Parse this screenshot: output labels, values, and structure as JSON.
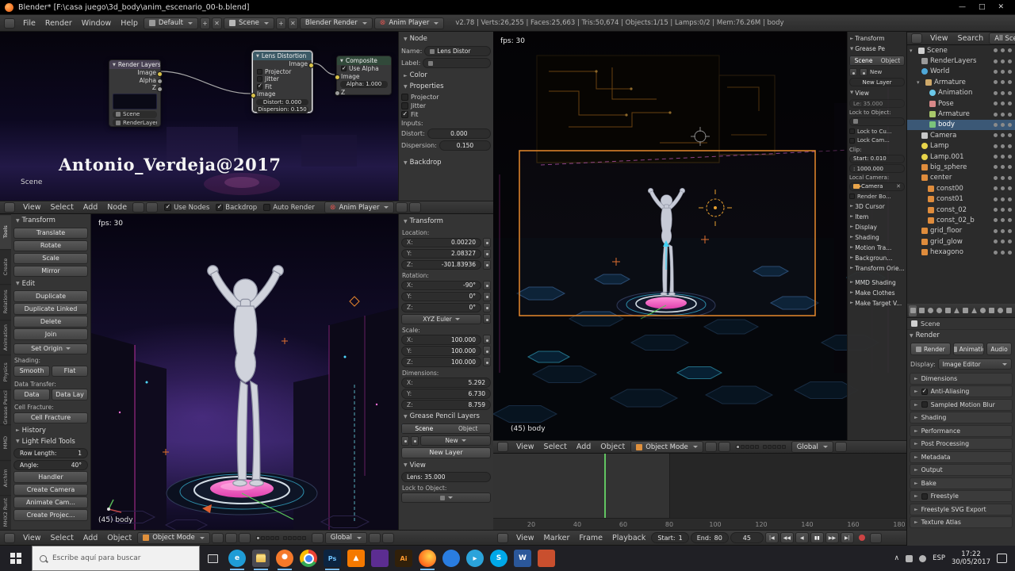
{
  "colors": {
    "accent_blue": "#4f7cb8",
    "selection_orange": "#e8892c",
    "frame_line_green": "#62c462",
    "record_red": "#cc4444",
    "pink_platform": "#f050c0"
  },
  "titlebar": {
    "title": "Blender* [F:\\casa juego\\3d_body\\anim_escenario_00-b.blend]"
  },
  "topbar": {
    "menus": [
      "File",
      "Render",
      "Window",
      "Help"
    ],
    "layout": "Default",
    "scene": "Scene",
    "engine": "Blender Render",
    "anim_player": "Anim Player",
    "stats": "v2.78 | Verts:26,255 | Faces:25,663 | Tris:50,674 | Objects:1/15 | Lamps:0/2 | Mem:76.26M | body"
  },
  "node_editor": {
    "watermark": "Antonio_Verdeja@2017",
    "scene_label": "Scene",
    "header": {
      "menus": [
        "View",
        "Select",
        "Add",
        "Node"
      ],
      "use_nodes": "Use Nodes",
      "backdrop": "Backdrop",
      "auto_render": "Auto Render",
      "anim_player": "Anim Player"
    },
    "render_layers": {
      "title": "Render Layers",
      "out_image": "Image",
      "out_alpha": "Alpha",
      "out_z": "Z",
      "scene": "Scene",
      "layer": "RenderLayer"
    },
    "lens": {
      "title": "Lens Distortion",
      "out_image": "Image",
      "projector": "Projector",
      "jitter": "Jitter",
      "fit": "Fit",
      "in_image": "Image",
      "distort": "Distort: 0.000",
      "dispersion": "Dispersion: 0.150"
    },
    "composite": {
      "title": "Composite",
      "use_alpha": "Use Alpha",
      "image": "Image",
      "alpha": "Alpha: 1.000",
      "z": "Z"
    }
  },
  "node_props": {
    "section_node": "Node",
    "name_label": "Name:",
    "name_value": "Lens Distor",
    "label_label": "Label:",
    "section_color": "Color",
    "section_properties": "Properties",
    "projector": "Projector",
    "jitter": "Jitter",
    "fit": "Fit",
    "inputs_label": "Inputs:",
    "distort_label": "Distort:",
    "distort_value": "0.000",
    "dispersion_label": "Dispersion:",
    "dispersion_value": "0.150",
    "section_backdrop": "Backdrop"
  },
  "tool_shelf": {
    "tabs": [
      "Tools",
      "Create",
      "Relations",
      "Animation",
      "Physics",
      "Grease Pencil",
      "MMD",
      "Archim",
      "MHX2 Runt"
    ],
    "transform_title": "Transform",
    "transform_buttons": [
      "Translate",
      "Rotate",
      "Scale",
      "Mirror"
    ],
    "edit_title": "Edit",
    "edit_buttons": [
      "Duplicate",
      "Duplicate Linked",
      "Delete",
      "Join"
    ],
    "set_origin": "Set Origin",
    "shading_label": "Shading:",
    "smooth": "Smooth",
    "flat": "Flat",
    "data_transfer_label": "Data Transfer:",
    "data": "Data",
    "data_lay": "Data Lay",
    "cell_fracture_label": "Cell Fracture:",
    "cell_fracture": "Cell Fracture",
    "history_title": "History",
    "light_field_title": "Light Field Tools",
    "row_length_label": "Row Length:",
    "row_length_value": "1",
    "angle_label": "Angle:",
    "angle_value": "40°",
    "handler": "Handler",
    "create_camera": "Create Camera",
    "animate_camera": "Animate Cam...",
    "create_projector": "Create Projec..."
  },
  "viewport_left": {
    "fps": "fps: 30",
    "object_label": "(45) body"
  },
  "n_panel": {
    "transform_title": "Transform",
    "location_label": "Location:",
    "loc": [
      {
        "a": "X:",
        "v": "0.00220"
      },
      {
        "a": "Y:",
        "v": "2.08327"
      },
      {
        "a": "Z:",
        "v": "-301.83936"
      }
    ],
    "rotation_label": "Rotation:",
    "rot": [
      {
        "a": "X:",
        "v": "-90°"
      },
      {
        "a": "Y:",
        "v": "0°"
      },
      {
        "a": "Z:",
        "v": "0°"
      }
    ],
    "euler": "XYZ Euler",
    "scale_label": "Scale:",
    "scl": [
      {
        "a": "X:",
        "v": "100.000"
      },
      {
        "a": "Y:",
        "v": "100.000"
      },
      {
        "a": "Z:",
        "v": "100.000"
      }
    ],
    "dimensions_label": "Dimensions:",
    "dim": [
      {
        "a": "X:",
        "v": "5.292"
      },
      {
        "a": "Y:",
        "v": "6.730"
      },
      {
        "a": "Z:",
        "v": "8.759"
      }
    ],
    "gp_title": "Grease Pencil Layers",
    "gp_scene": "Scene",
    "gp_object": "Object",
    "gp_new": "New",
    "gp_new_layer": "New Layer",
    "view_title": "View",
    "lens": "Lens: 35.000",
    "lock_label": "Lock to Object:"
  },
  "viewport_left_header": {
    "menus": [
      "View",
      "Select",
      "Add",
      "Object"
    ],
    "mode": "Object Mode",
    "global": "Global"
  },
  "camera_view": {
    "fps": "fps: 30",
    "object_label": "(45) body"
  },
  "camera_n_panel": {
    "transform_title": "Transform",
    "grease_title": "Grease Pe",
    "gp_scene": "Scene",
    "gp_object": "Object",
    "gp_new": "New",
    "gp_new_layer": "New Layer",
    "view_title": "View",
    "lens": "Le: 35.000",
    "lock_to_object": "Lock to Object:",
    "camera_value": "Camera",
    "lock_to_cursor": "Lock to Cu...",
    "lock_camera": "Lock Cam...",
    "clip_label": "Clip:",
    "clip_start": "Start: 0.010",
    "clip_end": ": 1000.000",
    "local_camera": "Local Camera:",
    "render_border": "Render Bo...",
    "collapsed": [
      "3D Cursor",
      "Item",
      "Display",
      "Shading",
      "Motion Tra...",
      "Backgroun...",
      "Transform Orie...",
      "MMD Shading",
      "Make Clothes",
      "Make Target V..."
    ]
  },
  "camera_header": {
    "menus": [
      "View",
      "Select",
      "Add",
      "Object"
    ],
    "mode": "Object Mode",
    "global": "Global"
  },
  "timeline": {
    "numbers": [
      "20",
      "40",
      "60",
      "80",
      "100",
      "120",
      "140",
      "160",
      "180"
    ],
    "header": {
      "menus": [
        "View",
        "Marker",
        "Frame",
        "Playback"
      ],
      "start_label": "Start:",
      "start_value": "1",
      "end_label": "End:",
      "end_value": "80",
      "frame_value": "45",
      "buttons": [
        "|◀",
        "◀◀",
        "◀",
        "▮▮",
        "▶▶",
        "▶|"
      ]
    }
  },
  "outliner": {
    "header": {
      "view": "View",
      "search": "Search",
      "scope": "All Scenes"
    },
    "items": [
      {
        "label": "Scene"
      },
      {
        "label": "RenderLayers"
      },
      {
        "label": "World"
      },
      {
        "label": "Armature"
      },
      {
        "label": "Animation"
      },
      {
        "label": "Pose"
      },
      {
        "label": "Armature"
      },
      {
        "label": "body"
      },
      {
        "label": "Camera"
      },
      {
        "label": "Lamp"
      },
      {
        "label": "Lamp.001"
      },
      {
        "label": "big_sphere"
      },
      {
        "label": "center"
      },
      {
        "label": "const00"
      },
      {
        "label": "const01"
      },
      {
        "label": "const_02"
      },
      {
        "label": "const_02_b"
      },
      {
        "label": "grid_floor"
      },
      {
        "label": "grid_glow"
      },
      {
        "label": "hexagono"
      }
    ]
  },
  "properties": {
    "breadcrumb": "Scene",
    "render_title": "Render",
    "render_button": "Render",
    "animation_button": "Animatio",
    "audio_button": "Audio",
    "display_label": "Display:",
    "display_value": "Image Editor",
    "sections": [
      {
        "label": "Dimensions"
      },
      {
        "label": "Anti-Aliasing"
      },
      {
        "label": "Sampled Motion Blur"
      },
      {
        "label": "Shading"
      },
      {
        "label": "Performance"
      },
      {
        "label": "Post Processing"
      },
      {
        "label": "Metadata"
      },
      {
        "label": "Output"
      },
      {
        "label": "Bake"
      },
      {
        "label": "Freestyle"
      },
      {
        "label": "Freestyle SVG Export"
      },
      {
        "label": "Texture Atlas"
      }
    ]
  },
  "taskbar": {
    "search_placeholder": "Escribe aquí para buscar",
    "apps": [
      {
        "name": "edge",
        "glyph": "e",
        "color": "#1f9cd6"
      },
      {
        "name": "file-explorer",
        "glyph": "",
        "color": "#4a4a52"
      },
      {
        "name": "blender",
        "glyph": "",
        "color": "#f5792a"
      },
      {
        "name": "chrome",
        "glyph": "",
        "color": "#48a54a"
      },
      {
        "name": "photoshop",
        "glyph": "Ps",
        "color": "#0c2440"
      },
      {
        "name": "vlc",
        "glyph": "",
        "color": "#f57900"
      },
      {
        "name": "media-player",
        "glyph": "",
        "color": "#5c2d91"
      },
      {
        "name": "illustrator",
        "glyph": "Ai",
        "color": "#31200a"
      },
      {
        "name": "firefox",
        "glyph": "",
        "color": "#ff6219"
      },
      {
        "name": "browser",
        "glyph": "",
        "color": "#2a7de1"
      },
      {
        "name": "telegram",
        "glyph": "",
        "color": "#2ba3da"
      },
      {
        "name": "skype",
        "glyph": "S",
        "color": "#00a8e8"
      },
      {
        "name": "word",
        "glyph": "W",
        "color": "#2b579a"
      },
      {
        "name": "photos",
        "glyph": "",
        "color": "#c94f2e"
      }
    ],
    "tray_lang": "ESP",
    "time": "17:22",
    "date": "30/05/2017"
  }
}
